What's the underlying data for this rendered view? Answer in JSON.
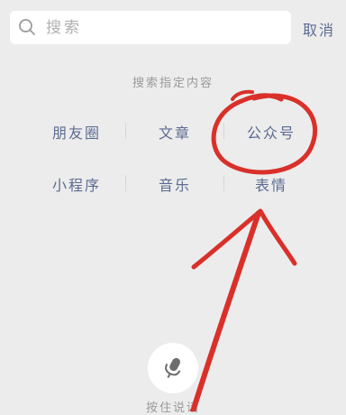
{
  "search": {
    "placeholder": "搜索",
    "icon": "search-icon"
  },
  "cancel_label": "取消",
  "section_title": "搜索指定内容",
  "categories": [
    {
      "label": "朋友圈"
    },
    {
      "label": "文章"
    },
    {
      "label": "公众号"
    },
    {
      "label": "小程序"
    },
    {
      "label": "音乐"
    },
    {
      "label": "表情"
    }
  ],
  "voice": {
    "label": "按住说话",
    "icon": "microphone-icon"
  },
  "colors": {
    "background": "#ececec",
    "link": "#5d6b92",
    "muted": "#9a9a9a",
    "annotation": "#d9302a"
  }
}
